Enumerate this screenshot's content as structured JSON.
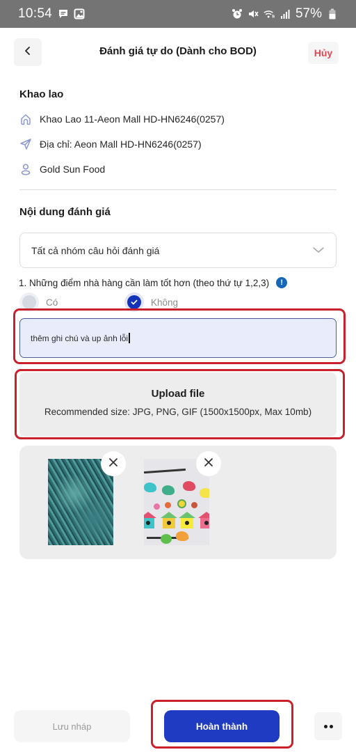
{
  "status_bar": {
    "time": "10:54",
    "left_icons": [
      "message-icon",
      "image-icon"
    ],
    "right_icons": [
      "alarm-icon",
      "mute-icon",
      "wifi-icon",
      "signal-icon"
    ],
    "battery_percent": "57%"
  },
  "header": {
    "back_icon": "chevron-left-icon",
    "title": "Đánh giá tự do (Dành cho BOD)",
    "cancel_label": "Hủy"
  },
  "store": {
    "title": "Khao lao",
    "name": "Khao Lao 11-Aeon Mall HD-HN6246(0257)",
    "address": "Địa chỉ: Aeon Mall HD-HN6246(0257)",
    "company": "Gold Sun Food"
  },
  "evaluation": {
    "section_title": "Nội dung đánh giá",
    "group_select": {
      "value": "Tất cả nhóm câu hỏi đánh giá"
    },
    "question": {
      "text": "1. Những điểm nhà hàng cần làm tốt hơn (theo thứ tự 1,2,3)",
      "info_icon": "!",
      "options": [
        {
          "label": "Có",
          "selected": false
        },
        {
          "label": "Không",
          "selected": true
        }
      ],
      "note_value": "thêm ghi chú và up ảnh lỗi"
    },
    "upload": {
      "title": "Upload file",
      "subtitle": "Recommended size: JPG, PNG, GIF (1500x1500px, Max 10mb)"
    },
    "images": [
      {
        "description": "teal textured surface photo"
      },
      {
        "description": "colorful birds and birdhouses illustration"
      }
    ]
  },
  "footer": {
    "draft_label": "Lưu nháp",
    "done_label": "Hoàn thành",
    "more_icon": "more-dots-icon"
  },
  "colors": {
    "primary": "#1f3bc2",
    "cancel_red": "#e0464f",
    "highlight_red": "#c8212c",
    "info_blue": "#1566b8"
  }
}
